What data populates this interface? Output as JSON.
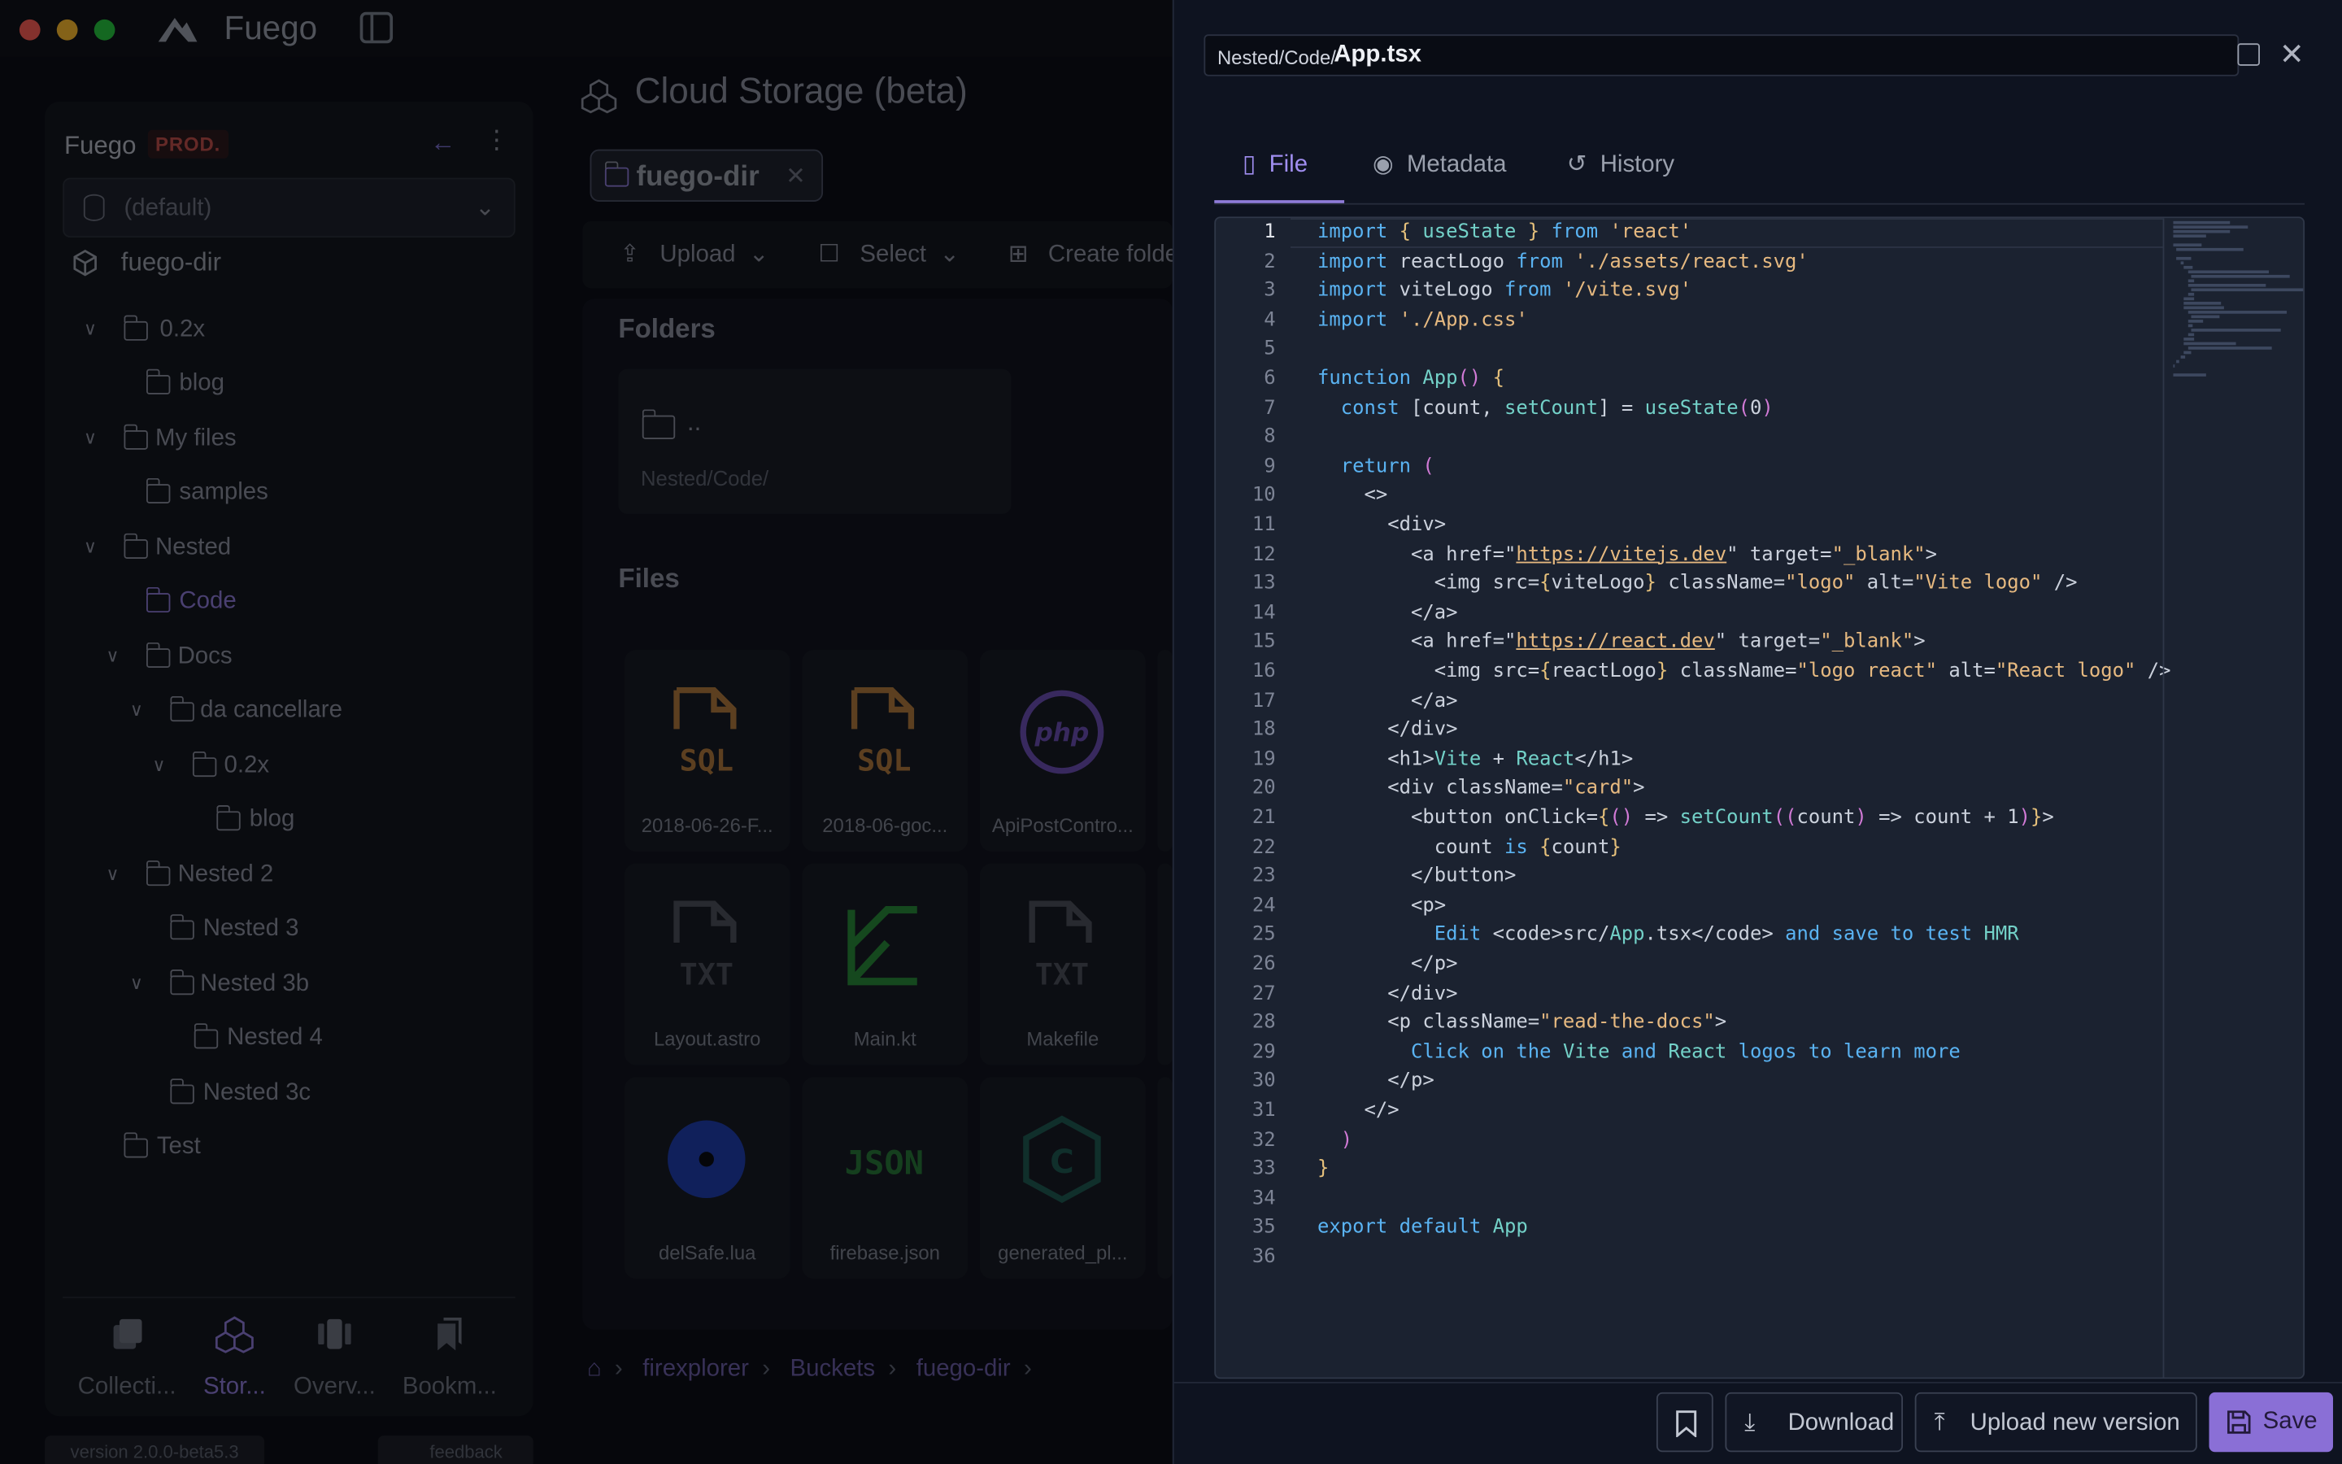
{
  "app": {
    "name": "Fuego"
  },
  "sidebar": {
    "title": "Fuego",
    "env_badge": "PROD.",
    "db_select": "(default)",
    "bucket": "fuego-dir",
    "tree": [
      {
        "label": "0.2x"
      },
      {
        "label": "blog"
      },
      {
        "label": "My files"
      },
      {
        "label": "samples"
      },
      {
        "label": "Nested"
      },
      {
        "label": "Code"
      },
      {
        "label": "Docs"
      },
      {
        "label": "da cancellare"
      },
      {
        "label": "0.2x"
      },
      {
        "label": "blog"
      },
      {
        "label": "Nested 2"
      },
      {
        "label": "Nested 3"
      },
      {
        "label": "Nested 3b"
      },
      {
        "label": "Nested 4"
      },
      {
        "label": "Nested 3c"
      },
      {
        "label": "Test"
      }
    ],
    "nav": [
      {
        "label": "Collecti...",
        "icon": "collections-icon"
      },
      {
        "label": "Stor...",
        "icon": "storage-icon"
      },
      {
        "label": "Overv...",
        "icon": "overview-icon"
      },
      {
        "label": "Bookm...",
        "icon": "bookmarks-icon"
      }
    ],
    "version": "version 2.0.0-beta5.3",
    "feedback": "feedback"
  },
  "main": {
    "title": "Cloud Storage (beta)",
    "tab": "fuego-dir",
    "toolbar": {
      "upload": "Upload",
      "select": "Select",
      "create_folder": "Create folde"
    },
    "folders_title": "Folders",
    "folder_card": {
      "name": "..",
      "path": "Nested/Code/"
    },
    "files_title": "Files",
    "files": [
      {
        "name": "2018-06-26-F...",
        "icon": "sql-file-icon"
      },
      {
        "name": "2018-06-goc...",
        "icon": "sql-file-icon"
      },
      {
        "name": "ApiPostContro...",
        "icon": "php-file-icon"
      },
      {
        "name": "Layout.astro",
        "icon": "txt-file-icon"
      },
      {
        "name": "Main.kt",
        "icon": "kotlin-file-icon"
      },
      {
        "name": "Makefile",
        "icon": "txt-file-icon"
      },
      {
        "name": "delSafe.lua",
        "icon": "lua-file-icon"
      },
      {
        "name": "firebase.json",
        "icon": "json-file-icon"
      },
      {
        "name": "generated_pl...",
        "icon": "c-file-icon"
      }
    ],
    "breadcrumb": [
      "firexplorer",
      "Buckets",
      "fuego-dir"
    ]
  },
  "drawer": {
    "path_dir": "Nested/Code/",
    "file_name": "App.tsx",
    "tabs": {
      "file": "File",
      "metadata": "Metadata",
      "history": "History"
    },
    "buttons": {
      "download": "Download",
      "upload_new": "Upload new version",
      "save": "Save"
    }
  },
  "editor": {
    "line_numbers": [
      "1",
      "2",
      "3",
      "4",
      "5",
      "6",
      "7",
      "8",
      "9",
      "10",
      "11",
      "12",
      "13",
      "14",
      "15",
      "16",
      "17",
      "18",
      "19",
      "20",
      "21",
      "22",
      "23",
      "24",
      "25",
      "26",
      "27",
      "28",
      "29",
      "30",
      "31",
      "32",
      "33",
      "34",
      "35",
      "36"
    ],
    "lines": [
      "import { useState } from 'react'",
      "import reactLogo from './assets/react.svg'",
      "import viteLogo from '/vite.svg'",
      "import './App.css'",
      "",
      "function App() {",
      "  const [count, setCount] = useState(0)",
      "",
      "  return (",
      "    <>",
      "      <div>",
      "        <a href=\"https://vitejs.dev\" target=\"_blank\">",
      "          <img src={viteLogo} className=\"logo\" alt=\"Vite logo\" />",
      "        </a>",
      "        <a href=\"https://react.dev\" target=\"_blank\">",
      "          <img src={reactLogo} className=\"logo react\" alt=\"React logo\" />",
      "        </a>",
      "      </div>",
      "      <h1>Vite + React</h1>",
      "      <div className=\"card\">",
      "        <button onClick={() => setCount((count) => count + 1)}>",
      "          count is {count}",
      "        </button>",
      "        <p>",
      "          Edit <code>src/App.tsx</code> and save to test HMR",
      "        </p>",
      "      </div>",
      "      <p className=\"read-the-docs\">",
      "        Click on the Vite and React logos to learn more",
      "      </p>",
      "    </>",
      "  )",
      "}",
      "",
      "export default App",
      ""
    ]
  }
}
